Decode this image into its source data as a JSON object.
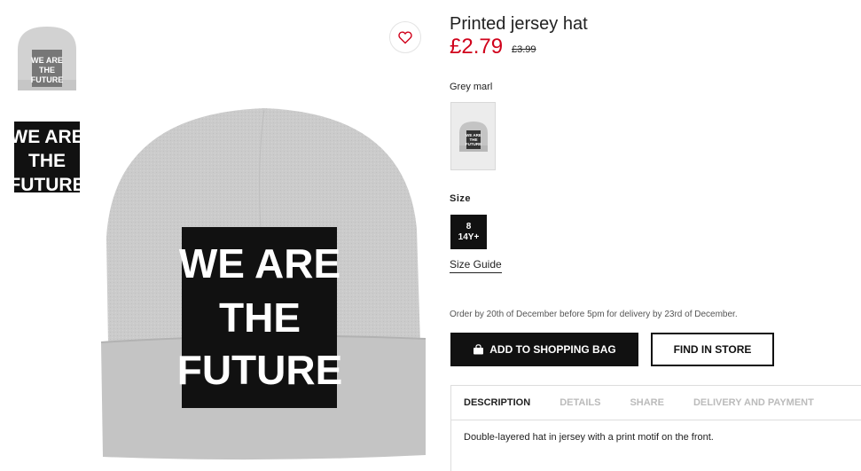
{
  "gallery": {
    "hat_text": [
      "WE ARE",
      "THE",
      "FUTURE"
    ]
  },
  "product": {
    "title": "Printed jersey hat",
    "price": "£2.79",
    "old_price": "£3.99",
    "color_label": "Grey marl",
    "size_label": "Size",
    "size_option": [
      "8",
      "14Y+"
    ],
    "size_guide": "Size Guide",
    "delivery_note": "Order by 20th of December before 5pm for delivery by 23rd of December.",
    "add_to_bag": "ADD TO SHOPPING BAG",
    "find_in_store": "FIND IN STORE"
  },
  "tabs": [
    {
      "label": "DESCRIPTION",
      "active": true
    },
    {
      "label": "DETAILS",
      "active": false
    },
    {
      "label": "SHARE",
      "active": false
    },
    {
      "label": "DELIVERY AND PAYMENT",
      "active": false
    }
  ],
  "description": "Double-layered hat in jersey with a print motif on the front.",
  "icons": [
    "heart-icon",
    "shopping-bag-icon"
  ],
  "colors": {
    "price_red": "#d0021b",
    "hat_grey": "#c9c9c9",
    "print_black": "#111111"
  }
}
